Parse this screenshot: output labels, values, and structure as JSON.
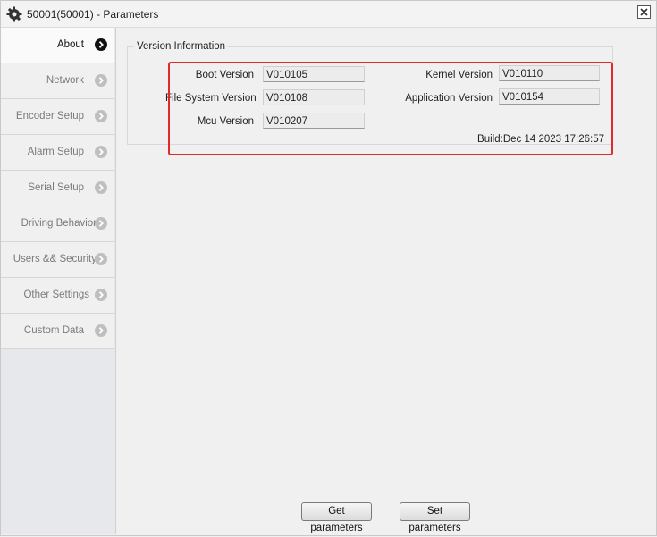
{
  "window": {
    "title": "50001(50001) - Parameters"
  },
  "sidebar": {
    "items": [
      {
        "label": "About",
        "active": true
      },
      {
        "label": "Network",
        "active": false
      },
      {
        "label": "Encoder Setup",
        "active": false
      },
      {
        "label": "Alarm Setup",
        "active": false
      },
      {
        "label": "Serial Setup",
        "active": false
      },
      {
        "label": "Driving Behavior",
        "active": false
      },
      {
        "label": "Users && Security",
        "active": false
      },
      {
        "label": "Other Settings",
        "active": false
      },
      {
        "label": "Custom Data",
        "active": false
      }
    ]
  },
  "version_info": {
    "group_title": "Version Information",
    "boot_label": "Boot Version",
    "boot_value": "V010105",
    "kernel_label": "Kernel Version",
    "kernel_value": "V010110",
    "fs_label": "File System Version",
    "fs_value": "V010108",
    "app_label": "Application Version",
    "app_value": "V010154",
    "mcu_label": "Mcu Version",
    "mcu_value": "V010207",
    "build": "Build:Dec 14 2023 17:26:57"
  },
  "buttons": {
    "get_label": "Get parameters",
    "set_label": "Set parameters"
  },
  "colors": {
    "highlight": "#e02b2b",
    "active_arrow": "#111111",
    "inactive_arrow": "#bfbfbf"
  }
}
